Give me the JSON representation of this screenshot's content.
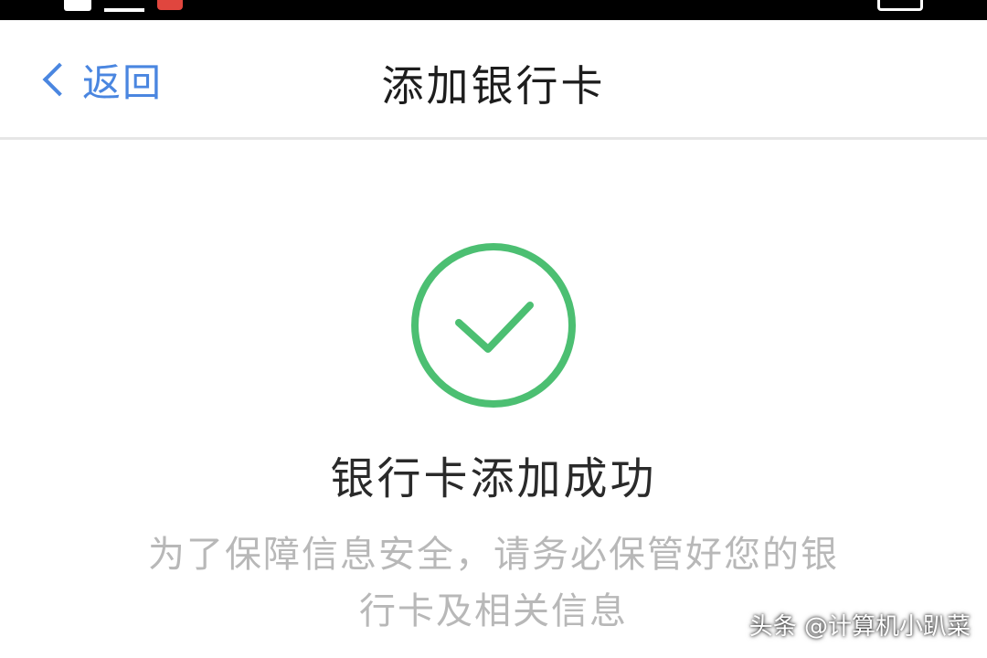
{
  "nav": {
    "back_label": "返回",
    "title": "添加银行卡"
  },
  "result": {
    "icon": "check-circle-icon",
    "title": "银行卡添加成功",
    "description_line1": "为了保障信息安全，请务必保管好您的银",
    "description_line2": "行卡及相关信息"
  },
  "watermark": "头条 @计算机小趴菜",
  "colors": {
    "accent_blue": "#4a86e0",
    "success_green": "#4cbf72",
    "muted_text": "#b8b8b8"
  }
}
